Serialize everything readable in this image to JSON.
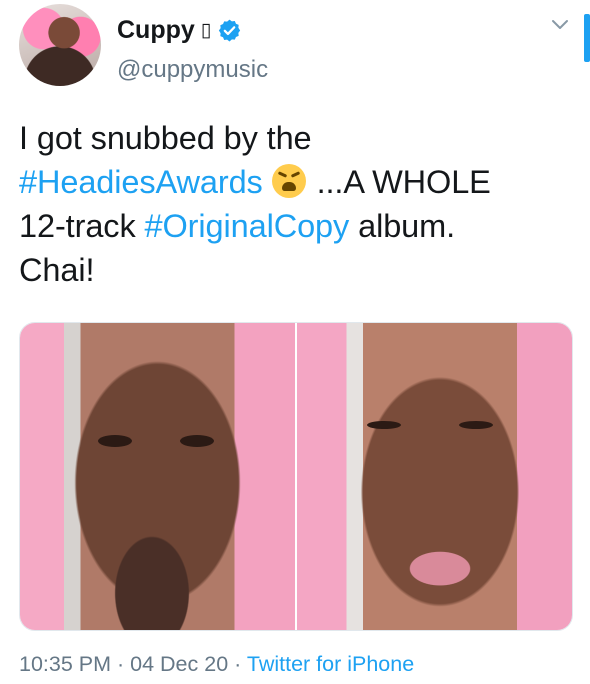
{
  "author": {
    "name": "Cuppy",
    "name_emoji": "▯",
    "handle": "@cuppymusic"
  },
  "tweet": {
    "line1": "I got snubbed by the",
    "hashtag1": "#HeadiesAwards",
    "emoji": "weary-face",
    "after_emoji": " ...A WHOLE",
    "line3_a": "12-track ",
    "hashtag2": "#OriginalCopy",
    "line3_b": " album.",
    "line4": "Chai!"
  },
  "meta": {
    "time": "10:35 PM",
    "sep1": " · ",
    "date": "04 Dec 20",
    "sep2": " · ",
    "source": "Twitter for iPhone"
  },
  "colors": {
    "accent": "#1da1f2",
    "secondary_text": "#657786",
    "text": "#14171a"
  }
}
